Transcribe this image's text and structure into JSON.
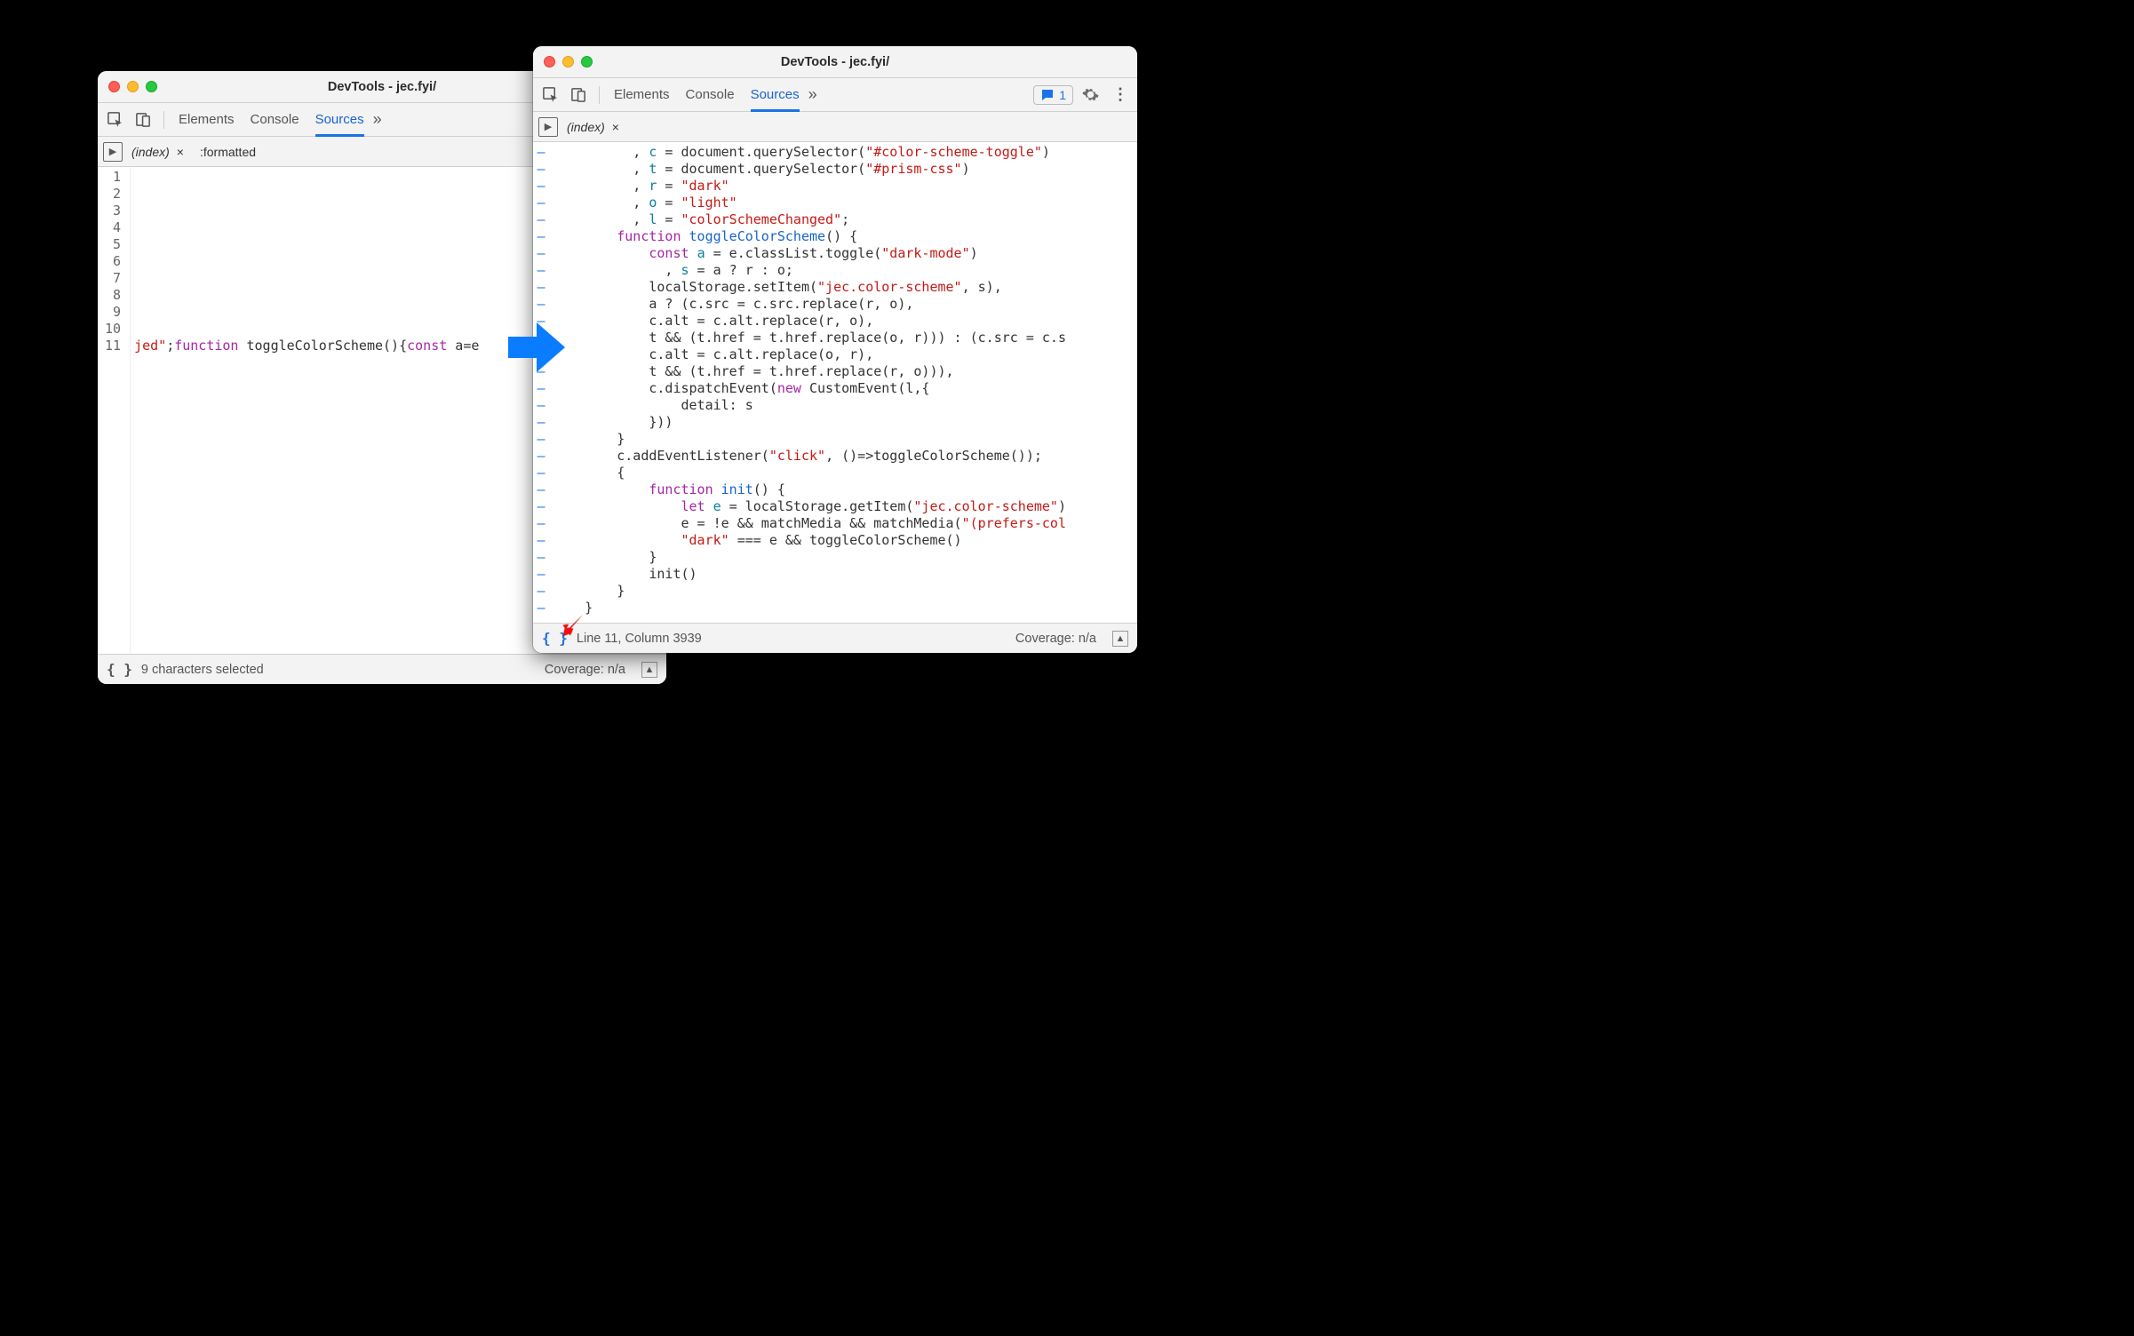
{
  "windows": {
    "left": {
      "title": "DevTools - jec.fyi/",
      "tabs": {
        "elements": "Elements",
        "console": "Console",
        "sources": "Sources"
      },
      "files": {
        "index": "(index)",
        "formatted": ":formatted"
      },
      "gutter": [
        "1",
        "2",
        "3",
        "4",
        "5",
        "6",
        "7",
        "8",
        "9",
        "10",
        "11"
      ],
      "code_lines": [
        "",
        "",
        "",
        "",
        "",
        "",
        "",
        "",
        "",
        "",
        "jed\";function toggleColorScheme(){const a=e"
      ],
      "status": {
        "format_icon": "{ }",
        "msg": "9 characters selected",
        "coverage": "Coverage: n/a"
      }
    },
    "right": {
      "title": "DevTools - jec.fyi/",
      "tabs": {
        "elements": "Elements",
        "console": "Console",
        "sources": "Sources"
      },
      "issues_count": "1",
      "files": {
        "index": "(index)"
      },
      "status": {
        "format_icon": "{ }",
        "msg": "Line 11, Column 3939",
        "coverage": "Coverage: n/a"
      }
    }
  }
}
